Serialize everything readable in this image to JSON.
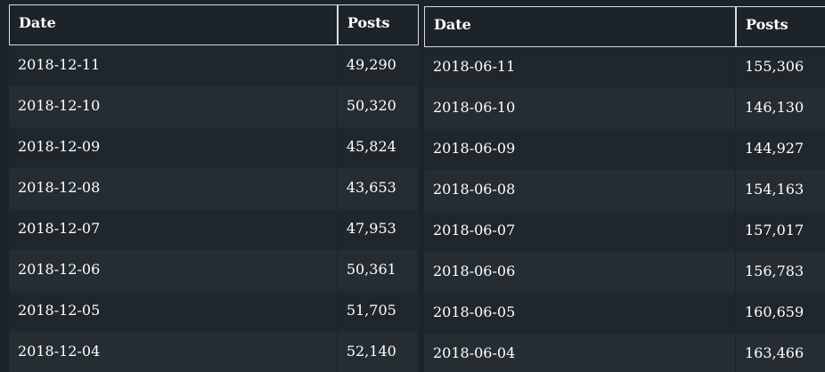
{
  "left_table": {
    "headers": [
      "Date",
      "Posts"
    ],
    "rows": [
      [
        "2018-12-11",
        "49,290"
      ],
      [
        "2018-12-10",
        "50,320"
      ],
      [
        "2018-12-09",
        "45,824"
      ],
      [
        "2018-12-08",
        "43,653"
      ],
      [
        "2018-12-07",
        "47,953"
      ],
      [
        "2018-12-06",
        "50,361"
      ],
      [
        "2018-12-05",
        "51,705"
      ],
      [
        "2018-12-04",
        "52,140"
      ]
    ]
  },
  "right_table": {
    "headers": [
      "Date",
      "Posts"
    ],
    "rows": [
      [
        "2018-06-11",
        "155,306"
      ],
      [
        "2018-06-10",
        "146,130"
      ],
      [
        "2018-06-09",
        "144,927"
      ],
      [
        "2018-06-08",
        "154,163"
      ],
      [
        "2018-06-07",
        "157,017"
      ],
      [
        "2018-06-06",
        "156,783"
      ],
      [
        "2018-06-05",
        "160,659"
      ],
      [
        "2018-06-04",
        "163,466"
      ]
    ]
  },
  "colors": {
    "background": "#1c2329",
    "row_alt": "#252d33",
    "header_border": "#d8dde2",
    "text": "#ffffff"
  }
}
